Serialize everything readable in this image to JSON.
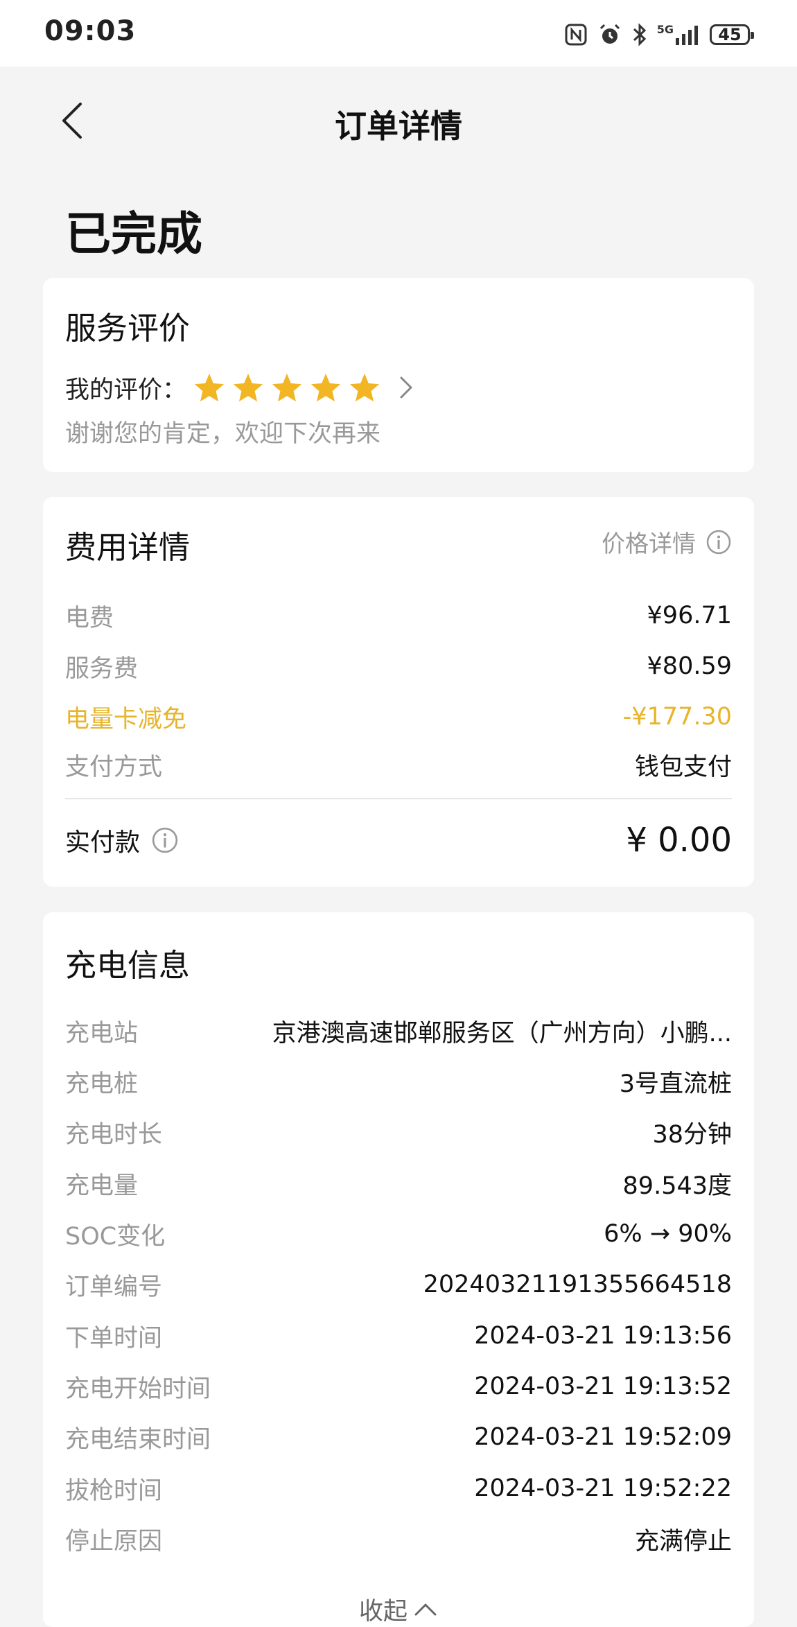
{
  "status_bar": {
    "time": "09:03",
    "battery": "45",
    "network": "5G",
    "icons": [
      "nfc-icon",
      "alarm-icon",
      "bluetooth-icon",
      "signal-icon",
      "battery-icon"
    ]
  },
  "nav": {
    "title": "订单详情",
    "back_icon": "chevron-left-icon"
  },
  "order_status": "已完成",
  "rating": {
    "title": "服务评价",
    "label": "我的评价：",
    "stars": 5,
    "star_color": "#f2b523",
    "thanks": "谢谢您的肯定，欢迎下次再来"
  },
  "fee": {
    "title": "费用详情",
    "price_detail_link": "价格详情",
    "rows": [
      {
        "label": "电费",
        "value": "¥96.71"
      },
      {
        "label": "服务费",
        "value": "¥80.59"
      },
      {
        "label": "电量卡减免",
        "value": "-¥177.30"
      },
      {
        "label": "支付方式",
        "value": "钱包支付"
      }
    ],
    "paid_label": "实付款",
    "paid_value": "¥ 0.00",
    "discount_color": "#e8b42a"
  },
  "charge": {
    "title": "充电信息",
    "rows": [
      {
        "label": "充电站",
        "value": "京港澳高速邯郸服务区（广州方向）小鹏..."
      },
      {
        "label": "充电桩",
        "value": "3号直流桩"
      },
      {
        "label": "充电时长",
        "value": "38分钟"
      },
      {
        "label": "充电量",
        "value": "89.543度"
      },
      {
        "label": "SOC变化",
        "value": "6% → 90%"
      },
      {
        "label": "订单编号",
        "value": "2024032119135566 4518"
      },
      {
        "label": "下单时间",
        "value": "2024-03-21 19:13:56"
      },
      {
        "label": "充电开始时间",
        "value": "2024-03-21 19:13:52"
      },
      {
        "label": "充电结束时间",
        "value": "2024-03-21 19:52:09"
      },
      {
        "label": "拔枪时间",
        "value": "2024-03-21 19:52:22"
      },
      {
        "label": "停止原因",
        "value": "充满停止"
      }
    ],
    "collapse_label": "收起"
  }
}
